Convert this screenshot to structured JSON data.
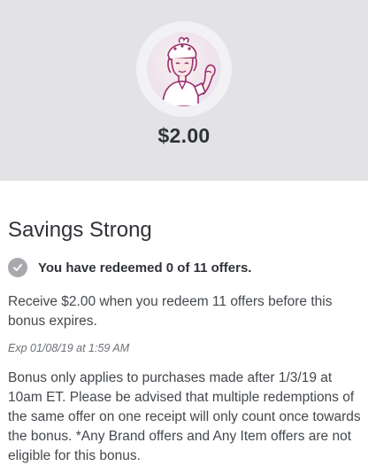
{
  "bonus": {
    "badge_icon": "flexing-woman-icon",
    "amount": "$2.00",
    "title": "Savings Strong",
    "status_icon": "check-circle-icon",
    "status_text": "You have redeemed 0 of 11 offers.",
    "description": "Receive $2.00 when you redeem 11 offers before this bonus expires.",
    "expiry": "Exp 01/08/19 at 1:59 AM",
    "terms": "Bonus only applies to purchases made after 1/3/19 at 10am ET. Please be advised that multiple redemptions of the same offer on one receipt will only count once towards the bonus. *Any Brand offers and Any Item offers are not eligible for this bonus."
  },
  "colors": {
    "hero_background": "#e3e3e6",
    "badge_accent": "#9b2f6e",
    "status_check": "#a7a9ad",
    "text_primary": "#2f3237"
  }
}
